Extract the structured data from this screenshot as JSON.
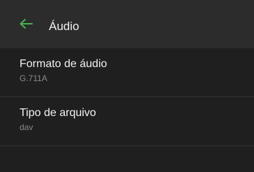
{
  "appbar": {
    "title": "Áudio",
    "back_icon": "arrow-left-icon",
    "accent_color": "#4caf50"
  },
  "settings": [
    {
      "title": "Formato de áudio",
      "value": "G.711A"
    },
    {
      "title": "Tipo de arquivo",
      "value": "dav"
    }
  ]
}
